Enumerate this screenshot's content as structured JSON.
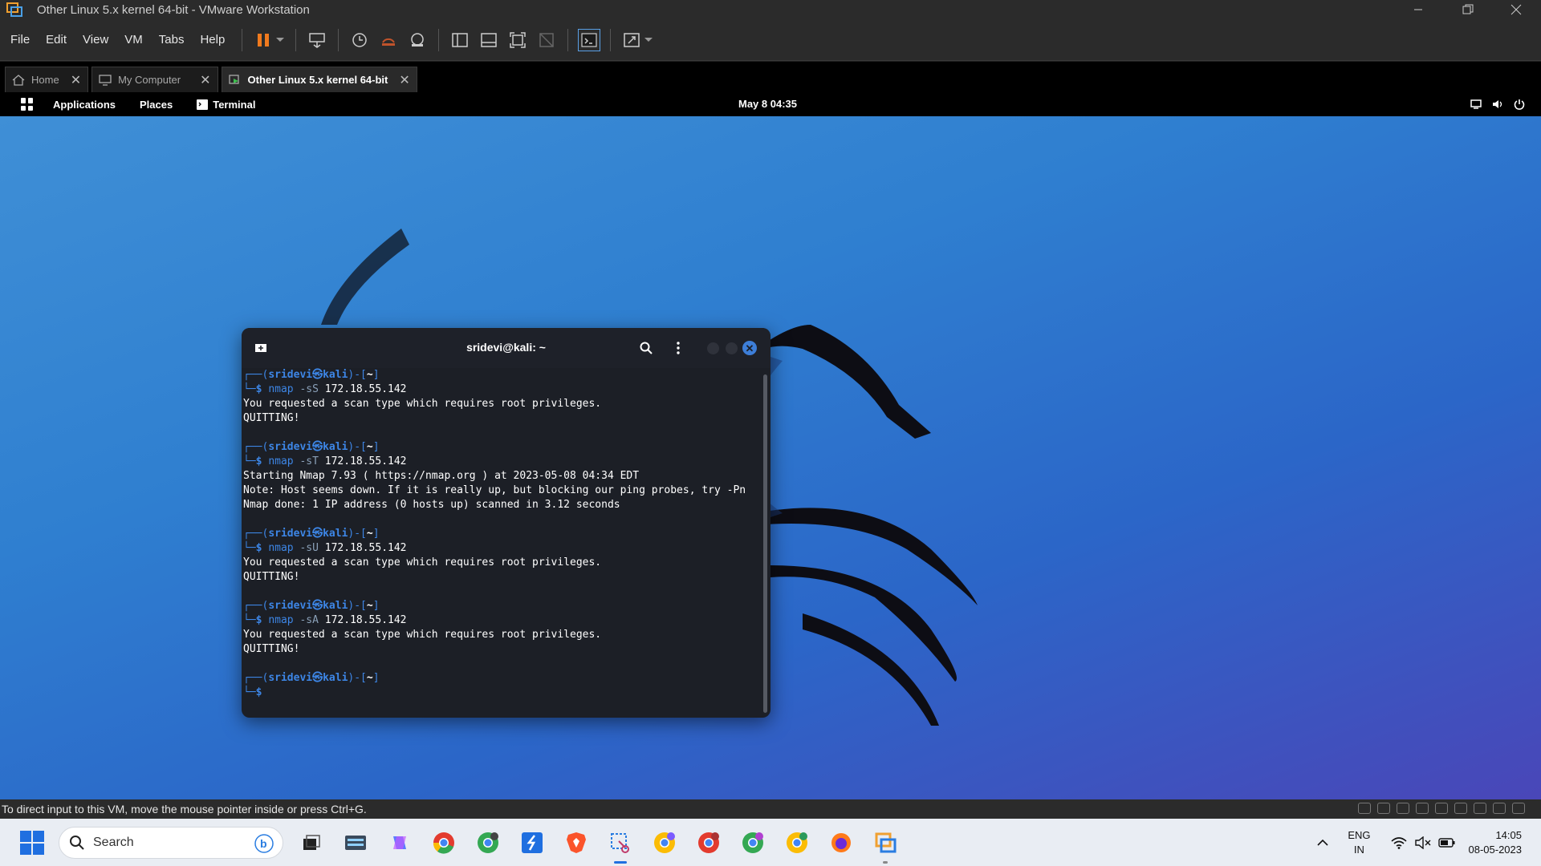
{
  "window": {
    "title": "Other Linux 5.x kernel 64-bit - VMware Workstation"
  },
  "menubar": {
    "items": [
      "File",
      "Edit",
      "View",
      "VM",
      "Tabs",
      "Help"
    ]
  },
  "tabs": [
    {
      "label": "Home",
      "icon": "home-icon"
    },
    {
      "label": "My Computer",
      "icon": "computer-icon"
    },
    {
      "label": "Other Linux 5.x kernel 64-bit",
      "icon": "vm-icon",
      "active": true
    }
  ],
  "kali_panel": {
    "applications": "Applications",
    "places": "Places",
    "terminal": "Terminal",
    "clock": "May 8  04:35"
  },
  "terminal": {
    "title": "sridevi@kali: ~",
    "prompt_user": "sridevi",
    "prompt_host": "kali",
    "lines": [
      {
        "type": "prompt_top",
        "text": "┌──(sridevi㉿kali)-[~]"
      },
      {
        "type": "prompt_cmd",
        "cmd": "nmap",
        "flag": "-sS",
        "arg": "172.18.55.142"
      },
      {
        "type": "out",
        "text": "You requested a scan type which requires root privileges."
      },
      {
        "type": "out",
        "text": "QUITTING!"
      },
      {
        "type": "blank",
        "text": ""
      },
      {
        "type": "prompt_top",
        "text": "┌──(sridevi㉿kali)-[~]"
      },
      {
        "type": "prompt_cmd",
        "cmd": "nmap",
        "flag": "-sT",
        "arg": "172.18.55.142"
      },
      {
        "type": "out",
        "text": "Starting Nmap 7.93 ( https://nmap.org ) at 2023-05-08 04:34 EDT"
      },
      {
        "type": "out",
        "text": "Note: Host seems down. If it is really up, but blocking our ping probes, try -Pn"
      },
      {
        "type": "out",
        "text": "Nmap done: 1 IP address (0 hosts up) scanned in 3.12 seconds"
      },
      {
        "type": "blank",
        "text": ""
      },
      {
        "type": "prompt_top",
        "text": "┌──(sridevi㉿kali)-[~]"
      },
      {
        "type": "prompt_cmd",
        "cmd": "nmap",
        "flag": "-sU",
        "arg": "172.18.55.142"
      },
      {
        "type": "out",
        "text": "You requested a scan type which requires root privileges."
      },
      {
        "type": "out",
        "text": "QUITTING!"
      },
      {
        "type": "blank",
        "text": ""
      },
      {
        "type": "prompt_top",
        "text": "┌──(sridevi㉿kali)-[~]"
      },
      {
        "type": "prompt_cmd",
        "cmd": "nmap",
        "flag": "-sA",
        "arg": "172.18.55.142"
      },
      {
        "type": "out",
        "text": "You requested a scan type which requires root privileges."
      },
      {
        "type": "out",
        "text": "QUITTING!"
      },
      {
        "type": "blank",
        "text": ""
      },
      {
        "type": "prompt_top",
        "text": "┌──(sridevi㉿kali)-[~]"
      },
      {
        "type": "prompt_cmd",
        "cmd": "",
        "flag": "",
        "arg": ""
      }
    ]
  },
  "dock": {
    "items": [
      "terminal-icon",
      "files-icon",
      "text-editor-icon",
      "firefox-icon",
      "metasploit-icon",
      "wireshark-icon",
      "burpsuite-icon",
      "cherrytree-icon",
      "show-apps-icon"
    ]
  },
  "statusbar": {
    "message": "To direct input to this VM, move the mouse pointer inside or press Ctrl+G."
  },
  "taskbar": {
    "search_placeholder": "Search",
    "lang_line1": "ENG",
    "lang_line2": "IN",
    "time": "14:05",
    "date": "08-05-2023"
  },
  "colors": {
    "prompt_blue": "#3d86e6",
    "terminal_bg": "#1c1f26",
    "desktop_blue": "#2f7fd0",
    "windows_accent": "#1f6fe0"
  }
}
